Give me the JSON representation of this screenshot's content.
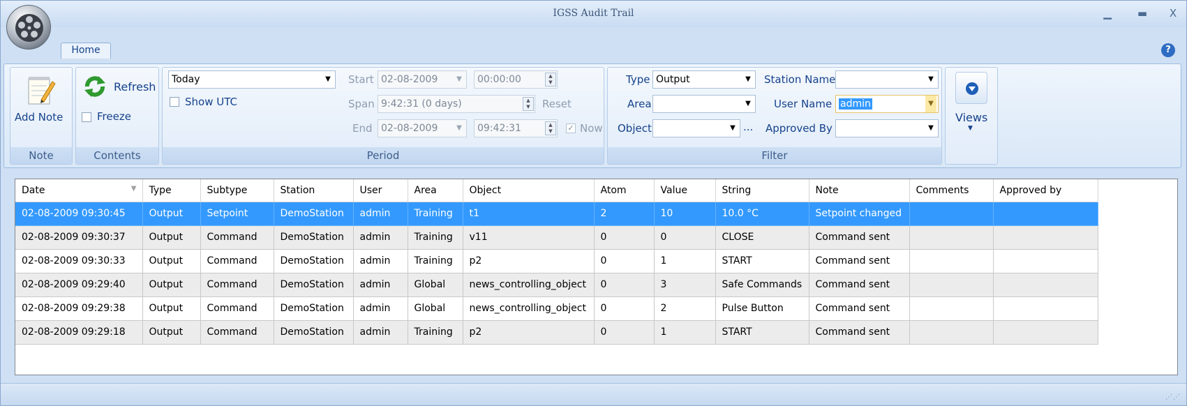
{
  "window": {
    "title": "IGSS Audit Trail"
  },
  "tabs": [
    {
      "label": "Home"
    }
  ],
  "groups": {
    "note": {
      "caption": "Note",
      "add_note_label": "Add Note"
    },
    "contents": {
      "caption": "Contents",
      "refresh_label": "Refresh",
      "freeze_label": "Freeze",
      "freeze_checked": false
    },
    "period": {
      "caption": "Period",
      "range_value": "Today",
      "show_utc_label": "Show UTC",
      "start_label": "Start",
      "start_date": "02-08-2009",
      "start_time": "00:00:00",
      "span_label": "Span",
      "span_value": "9:42:31 (0 days)",
      "reset_label": "Reset",
      "end_label": "End",
      "end_date": "02-08-2009",
      "end_time": "09:42:31",
      "now_label": "Now",
      "now_checked": true
    },
    "filter": {
      "caption": "Filter",
      "type_label": "Type",
      "type_value": "Output",
      "area_label": "Area",
      "area_value": "",
      "object_label": "Object",
      "object_value": "",
      "object_more": "...",
      "station_label": "Station Name",
      "station_value": "",
      "user_label": "User Name",
      "user_value": "admin",
      "approved_label": "Approved By",
      "approved_value": ""
    },
    "views": {
      "label": "Views"
    }
  },
  "grid": {
    "columns": [
      "Date",
      "Type",
      "Subtype",
      "Station",
      "User",
      "Area",
      "Object",
      "Atom",
      "Value",
      "String",
      "Note",
      "Comments",
      "Approved by"
    ],
    "rows": [
      [
        "02-08-2009 09:30:45",
        "Output",
        "Setpoint",
        "DemoStation",
        "admin",
        "Training",
        "t1",
        "2",
        "10",
        "10.0 °C",
        "Setpoint changed",
        "",
        ""
      ],
      [
        "02-08-2009 09:30:37",
        "Output",
        "Command",
        "DemoStation",
        "admin",
        "Training",
        "v11",
        "0",
        "0",
        "CLOSE",
        "Command sent",
        "",
        ""
      ],
      [
        "02-08-2009 09:30:33",
        "Output",
        "Command",
        "DemoStation",
        "admin",
        "Training",
        "p2",
        "0",
        "1",
        "START",
        "Command sent",
        "",
        ""
      ],
      [
        "02-08-2009 09:29:40",
        "Output",
        "Command",
        "DemoStation",
        "admin",
        "Global",
        "news_controlling_object",
        "0",
        "3",
        "Safe Commands",
        "Command sent",
        "",
        ""
      ],
      [
        "02-08-2009 09:29:38",
        "Output",
        "Command",
        "DemoStation",
        "admin",
        "Global",
        "news_controlling_object",
        "0",
        "2",
        "Pulse Button",
        "Command sent",
        "",
        ""
      ],
      [
        "02-08-2009 09:29:18",
        "Output",
        "Command",
        "DemoStation",
        "admin",
        "Training",
        "p2",
        "0",
        "1",
        "START",
        "Command sent",
        "",
        ""
      ]
    ],
    "selected_row": 0
  },
  "colors": {
    "selection": "#3399ff",
    "ribbon": "#d9e7f7",
    "accent_text": "#15428b"
  }
}
